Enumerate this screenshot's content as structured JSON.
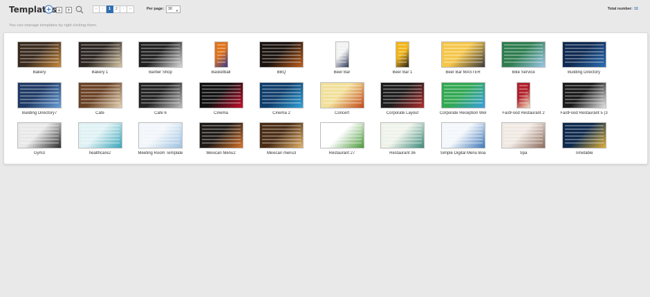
{
  "header": {
    "title": "Templates",
    "per_page_label": "Per page:",
    "per_page_value": "30",
    "total_label": "Total number:",
    "total_count": "32"
  },
  "pagination": {
    "prev_first": "‹‹",
    "prev": "‹",
    "pages": [
      "1",
      "2"
    ],
    "next": "›",
    "next_last": "››",
    "current": "1"
  },
  "hint": "You can manage templates by right clicking them.",
  "templates": [
    {
      "label": "Bakery",
      "colors": [
        "#3a2a1e",
        "#c98a3b"
      ]
    },
    {
      "label": "Bakery 1",
      "colors": [
        "#2b2420",
        "#d8c7a6"
      ]
    },
    {
      "label": "Barber Shop",
      "colors": [
        "#222",
        "#d9d9d9"
      ]
    },
    {
      "label": "Basketball",
      "colors": [
        "#e0731c",
        "#3a3a8a"
      ]
    },
    {
      "label": "BBQ",
      "colors": [
        "#1a120d",
        "#c25f1c"
      ]
    },
    {
      "label": "Beer Bar",
      "colors": [
        "#f2f2f2",
        "#2f3b5a"
      ]
    },
    {
      "label": "Beer Bar 1",
      "colors": [
        "#f1b51b",
        "#2b2218"
      ]
    },
    {
      "label": "Beer Bar MASTER",
      "colors": [
        "#f6c64a",
        "#3b3b3b"
      ]
    },
    {
      "label": "Bike Service",
      "colors": [
        "#2e7d4f",
        "#9bc7e8"
      ]
    },
    {
      "label": "Building Directory",
      "colors": [
        "#0f2a52",
        "#2d6fb7"
      ]
    },
    {
      "label": "Building Directory7",
      "colors": [
        "#1f3a66",
        "#6aa0d8"
      ]
    },
    {
      "label": "Cafe",
      "colors": [
        "#6b4226",
        "#e5d2b3"
      ]
    },
    {
      "label": "Cafe 6",
      "colors": [
        "#232323",
        "#bdbdbd"
      ]
    },
    {
      "label": "Cinema",
      "colors": [
        "#111",
        "#c8102e"
      ]
    },
    {
      "label": "Cinema 2",
      "colors": [
        "#0f3d6b",
        "#31a3d9"
      ]
    },
    {
      "label": "Concert",
      "colors": [
        "#f2e09a",
        "#c24a1a"
      ]
    },
    {
      "label": "Corporate Layout",
      "colors": [
        "#1c1c1c",
        "#b03030"
      ]
    },
    {
      "label": "Corporate Reception Wel",
      "colors": [
        "#32a852",
        "#3aa0e0"
      ]
    },
    {
      "label": "FastFood Restaurant 2",
      "colors": [
        "#b0202a",
        "#f3e1c2"
      ]
    },
    {
      "label": "FastFood Restaurant 5 (3",
      "colors": [
        "#1b1b1b",
        "#e6e6e6"
      ]
    },
    {
      "label": "Gym3",
      "colors": [
        "#e8e8e8",
        "#2b2b2b"
      ]
    },
    {
      "label": "healthcare2",
      "colors": [
        "#dff1f4",
        "#3aa6b9"
      ]
    },
    {
      "label": "Meeting Room Template",
      "colors": [
        "#f2f6fa",
        "#9ec2e3"
      ]
    },
    {
      "label": "Mexican Menu2",
      "colors": [
        "#1e1a17",
        "#d9752b"
      ]
    },
    {
      "label": "Mexican menu3",
      "colors": [
        "#4a2c15",
        "#e3b36a"
      ]
    },
    {
      "label": "Restaurant 27",
      "colors": [
        "#ffffff",
        "#4b9a3a"
      ]
    },
    {
      "label": "Restaurant 36",
      "colors": [
        "#eef3ea",
        "#3c8a7a"
      ]
    },
    {
      "label": "Simple Digital Menu Boa",
      "colors": [
        "#f3f7fb",
        "#3f78b8"
      ]
    },
    {
      "label": "Spa",
      "colors": [
        "#f0e8e2",
        "#8c6b5b"
      ]
    },
    {
      "label": "Timetable",
      "colors": [
        "#0e2a4d",
        "#e0b13a"
      ]
    }
  ]
}
